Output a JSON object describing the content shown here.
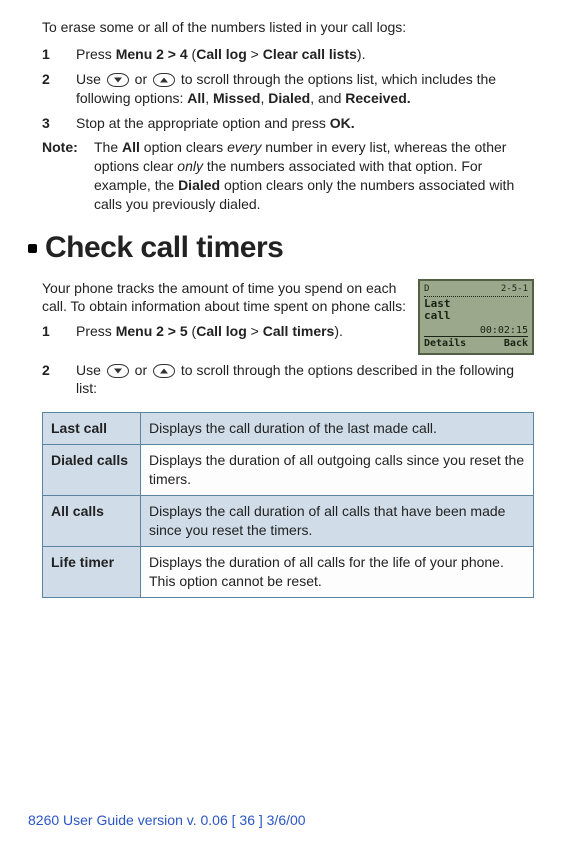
{
  "eraseLogs": {
    "intro": "To erase some or all of the numbers listed in your call logs:",
    "steps": [
      {
        "num": "1",
        "pre": "Press ",
        "b1": "Menu 2 > 4",
        "mid": " (",
        "b2": "Call log",
        "gt": " > ",
        "b3": "Clear call lists",
        "post": ")."
      },
      {
        "num": "2",
        "pre": "Use ",
        "mid": " or ",
        "post1": " to scroll through the options list, which includes the following options: ",
        "o1": "All",
        "c1": ", ",
        "o2": "Missed",
        "c2": ", ",
        "o3": "Dialed",
        "c3": ", and ",
        "o4": "Received."
      },
      {
        "num": "3",
        "pre": "Stop at the appropriate option and press ",
        "b1": "OK."
      }
    ],
    "note": {
      "label": "Note:",
      "pre": "The ",
      "b1": "All",
      "mid1": " option clears ",
      "i1": "every",
      "mid2": " number in every list, whereas the other options clear ",
      "i2": "only",
      "mid3": " the numbers associated with that option. For example, the ",
      "b2": "Dialed",
      "post": " option clears only the numbers associated with calls you previously dialed."
    }
  },
  "checkTimers": {
    "heading": "Check call timers",
    "intro": "Your phone tracks the amount of time you spend on each call. To obtain information about time spent on phone calls:",
    "phone": {
      "signal": "D",
      "date": "2-5-1",
      "line1": "Last",
      "line2": "call",
      "time": "00:02:15",
      "left": "Details",
      "right": "Back"
    },
    "steps": [
      {
        "num": "1",
        "pre": "Press ",
        "b1": "Menu 2 > 5",
        "mid": " (",
        "b2": "Call log",
        "gt": " > ",
        "b3": "Call timers",
        "post": ")."
      },
      {
        "num": "2",
        "pre": "Use ",
        "mid": " or ",
        "post": " to scroll through the options described in the following list:"
      }
    ],
    "table": [
      {
        "term": "Last call",
        "desc": "Displays the call duration of the last made call.",
        "shade": true
      },
      {
        "term": "Dialed calls",
        "desc": "Displays the duration of all outgoing calls since you reset the timers.",
        "shade": false
      },
      {
        "term": "All calls",
        "desc": "Displays the call duration of all calls that have been made since you reset the timers.",
        "shade": true
      },
      {
        "term": "Life timer",
        "desc": "Displays the duration of all calls for the life of your phone. This option cannot be reset.",
        "shade": false
      }
    ]
  },
  "footer": "8260 User Guide version v. 0.06 [ 36 ] 3/6/00"
}
